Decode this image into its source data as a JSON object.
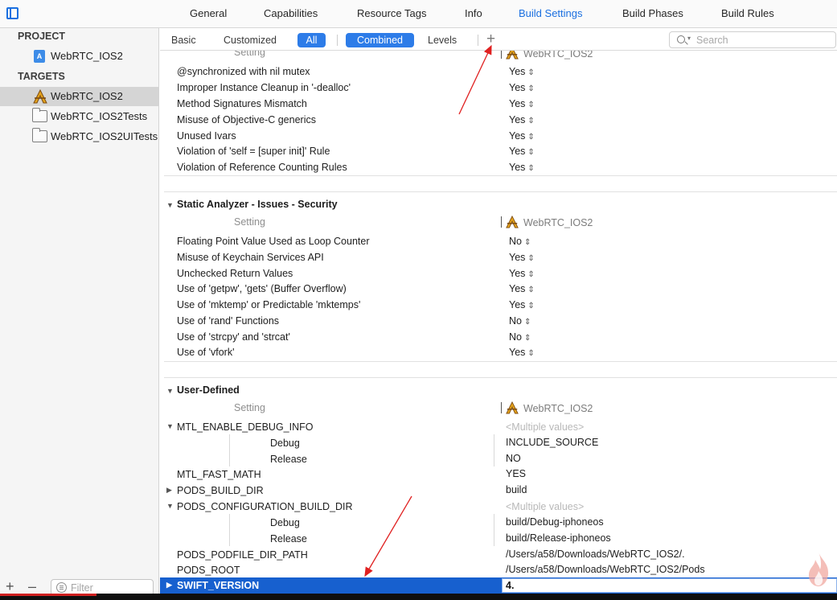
{
  "tabs": [
    "General",
    "Capabilities",
    "Resource Tags",
    "Info",
    "Build Settings",
    "Build Phases",
    "Build Rules"
  ],
  "active_tab": "Build Settings",
  "sidebar": {
    "project_header": "PROJECT",
    "project_item": "WebRTC_IOS2",
    "targets_header": "TARGETS",
    "targets": [
      "WebRTC_IOS2",
      "WebRTC_IOS2Tests",
      "WebRTC_IOS2UITests"
    ],
    "filter_placeholder": "Filter"
  },
  "filterbar": {
    "basic": "Basic",
    "customized": "Customized",
    "all": "All",
    "combined": "Combined",
    "levels": "Levels",
    "add": "+",
    "search_placeholder": "Search"
  },
  "column_target": "WebRTC_IOS2",
  "column_setting": "Setting",
  "objc_rows": [
    {
      "name": "@synchronized with nil mutex",
      "value": "Yes"
    },
    {
      "name": "Improper Instance Cleanup in '-dealloc'",
      "value": "Yes"
    },
    {
      "name": "Method Signatures Mismatch",
      "value": "Yes"
    },
    {
      "name": "Misuse of Objective-C generics",
      "value": "Yes"
    },
    {
      "name": "Unused Ivars",
      "value": "Yes"
    },
    {
      "name": "Violation of 'self = [super init]' Rule",
      "value": "Yes"
    },
    {
      "name": "Violation of Reference Counting Rules",
      "value": "Yes"
    }
  ],
  "security_section": {
    "title": "Static Analyzer - Issues - Security",
    "rows": [
      {
        "name": "Floating Point Value Used as Loop Counter",
        "value": "No"
      },
      {
        "name": "Misuse of Keychain Services API",
        "value": "Yes"
      },
      {
        "name": "Unchecked Return Values",
        "value": "Yes"
      },
      {
        "name": "Use of 'getpw', 'gets' (Buffer Overflow)",
        "value": "Yes"
      },
      {
        "name": "Use of 'mktemp' or Predictable 'mktemps'",
        "value": "Yes"
      },
      {
        "name": "Use of 'rand' Functions",
        "value": "No"
      },
      {
        "name": "Use of 'strcpy' and 'strcat'",
        "value": "No"
      },
      {
        "name": "Use of 'vfork'",
        "value": "Yes"
      }
    ]
  },
  "user_defined": {
    "title": "User-Defined",
    "mtl_debug": {
      "name": "MTL_ENABLE_DEBUG_INFO",
      "value": "<Multiple values>",
      "debug_label": "Debug",
      "debug_value": "INCLUDE_SOURCE",
      "release_label": "Release",
      "release_value": "NO"
    },
    "mtl_fast_math": {
      "name": "MTL_FAST_MATH",
      "value": "YES"
    },
    "pods_build_dir": {
      "name": "PODS_BUILD_DIR",
      "value": "build"
    },
    "pods_config": {
      "name": "PODS_CONFIGURATION_BUILD_DIR",
      "value": "<Multiple values>",
      "debug_label": "Debug",
      "debug_value": "build/Debug-iphoneos",
      "release_label": "Release",
      "release_value": "build/Release-iphoneos"
    },
    "pods_podfile": {
      "name": "PODS_PODFILE_DIR_PATH",
      "value": "/Users/a58/Downloads/WebRTC_IOS2/."
    },
    "pods_root": {
      "name": "PODS_ROOT",
      "value": "/Users/a58/Downloads/WebRTC_IOS2/Pods"
    },
    "swift_version": {
      "name": "SWIFT_VERSION",
      "value": "4."
    }
  },
  "colors": {
    "accent": "#2d7ce8",
    "selection": "#1760cf",
    "arrow": "#e02020"
  }
}
